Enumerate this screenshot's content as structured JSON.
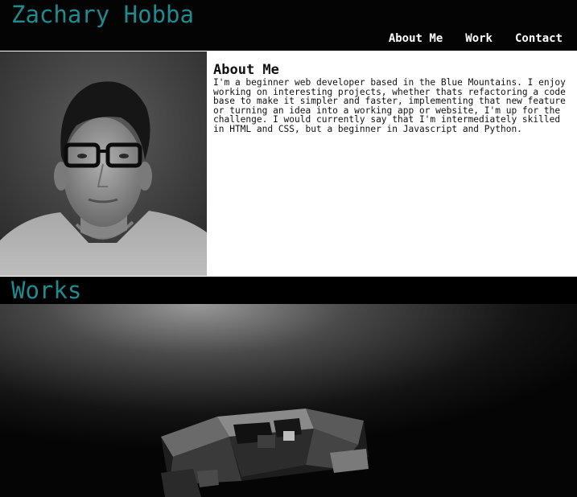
{
  "header": {
    "title": "Zachary Hobba",
    "nav": [
      "About Me",
      "Work",
      "Contact"
    ]
  },
  "about": {
    "heading": "About Me",
    "body": "I'm a beginner web developer based in the Blue Mountains. I enjoy working on interesting projects, whether thats refactoring a code base to make it simpler and faster, implementing that new feature or turning an idea into a working app or website, I'm up for the challenge. I would currently say that I'm intermediately skilled in HTML and CSS, but a beginner in Javascript and Python."
  },
  "works": {
    "heading": "Works"
  },
  "colors": {
    "accent": "#1f8a8f",
    "header_bg": "#040404",
    "page_bg": "#ffffff"
  }
}
